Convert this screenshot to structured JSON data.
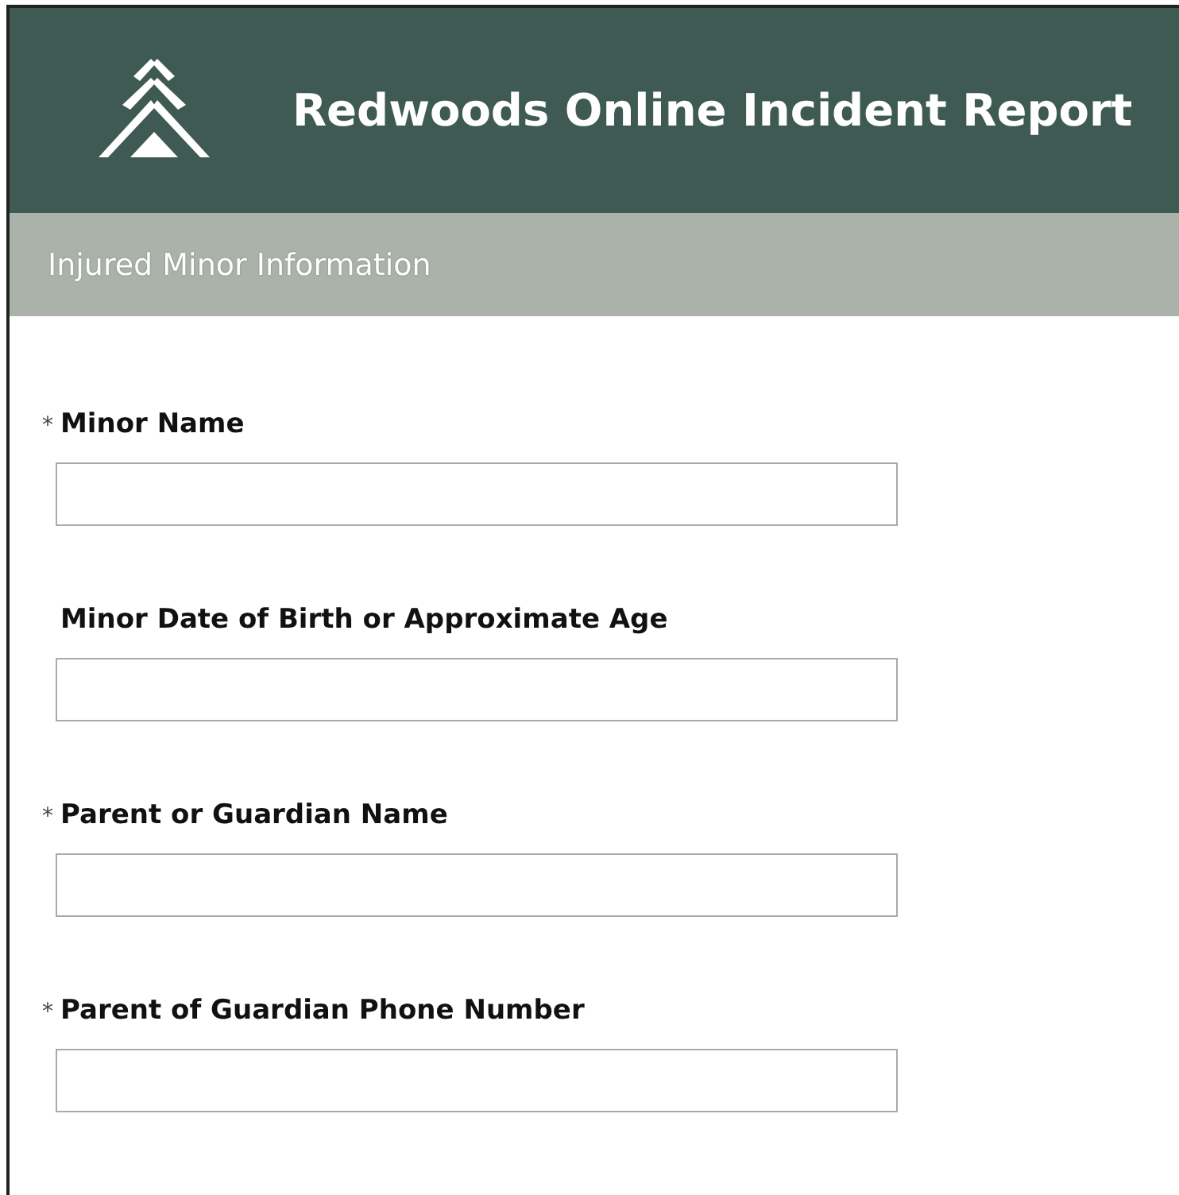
{
  "header": {
    "title": "Redwoods Online Incident Report"
  },
  "section": {
    "title": "Injured Minor Information"
  },
  "required_marker": "*",
  "fields": [
    {
      "label": "Minor Name",
      "required": true
    },
    {
      "label": "Minor Date of Birth or Approximate Age",
      "required": false
    },
    {
      "label": "Parent or Guardian Name",
      "required": true
    },
    {
      "label": "Parent of Guardian Phone Number",
      "required": true
    }
  ]
}
